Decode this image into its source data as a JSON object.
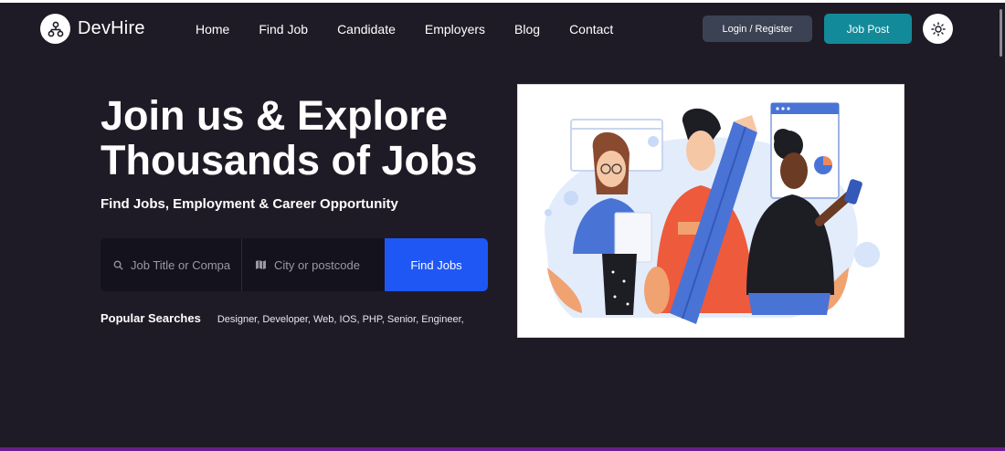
{
  "brand": {
    "name": "DevHire"
  },
  "nav": {
    "items": [
      {
        "label": "Home"
      },
      {
        "label": "Find Job"
      },
      {
        "label": "Candidate"
      },
      {
        "label": "Employers"
      },
      {
        "label": "Blog"
      },
      {
        "label": "Contact"
      }
    ]
  },
  "header": {
    "login_label": "Login / Register",
    "post_label": "Job Post"
  },
  "hero": {
    "title_line1": "Join us & Explore",
    "title_line2": "Thousands of Jobs",
    "subtitle": "Find Jobs, Employment & Career Opportunity"
  },
  "search": {
    "job_placeholder": "Job Title or Compa",
    "location_placeholder": "City or postcode",
    "button_label": "Find Jobs"
  },
  "popular": {
    "label": "Popular Searches",
    "terms": "Designer, Developer, Web, IOS, PHP, Senior, Engineer,"
  },
  "colors": {
    "background": "#1f1b26",
    "accent_blue": "#1f57f5",
    "accent_teal": "#138a99",
    "login_bg": "#3b4254"
  },
  "icons": [
    "network-logo-icon",
    "sun-icon",
    "search-icon",
    "map-icon"
  ]
}
